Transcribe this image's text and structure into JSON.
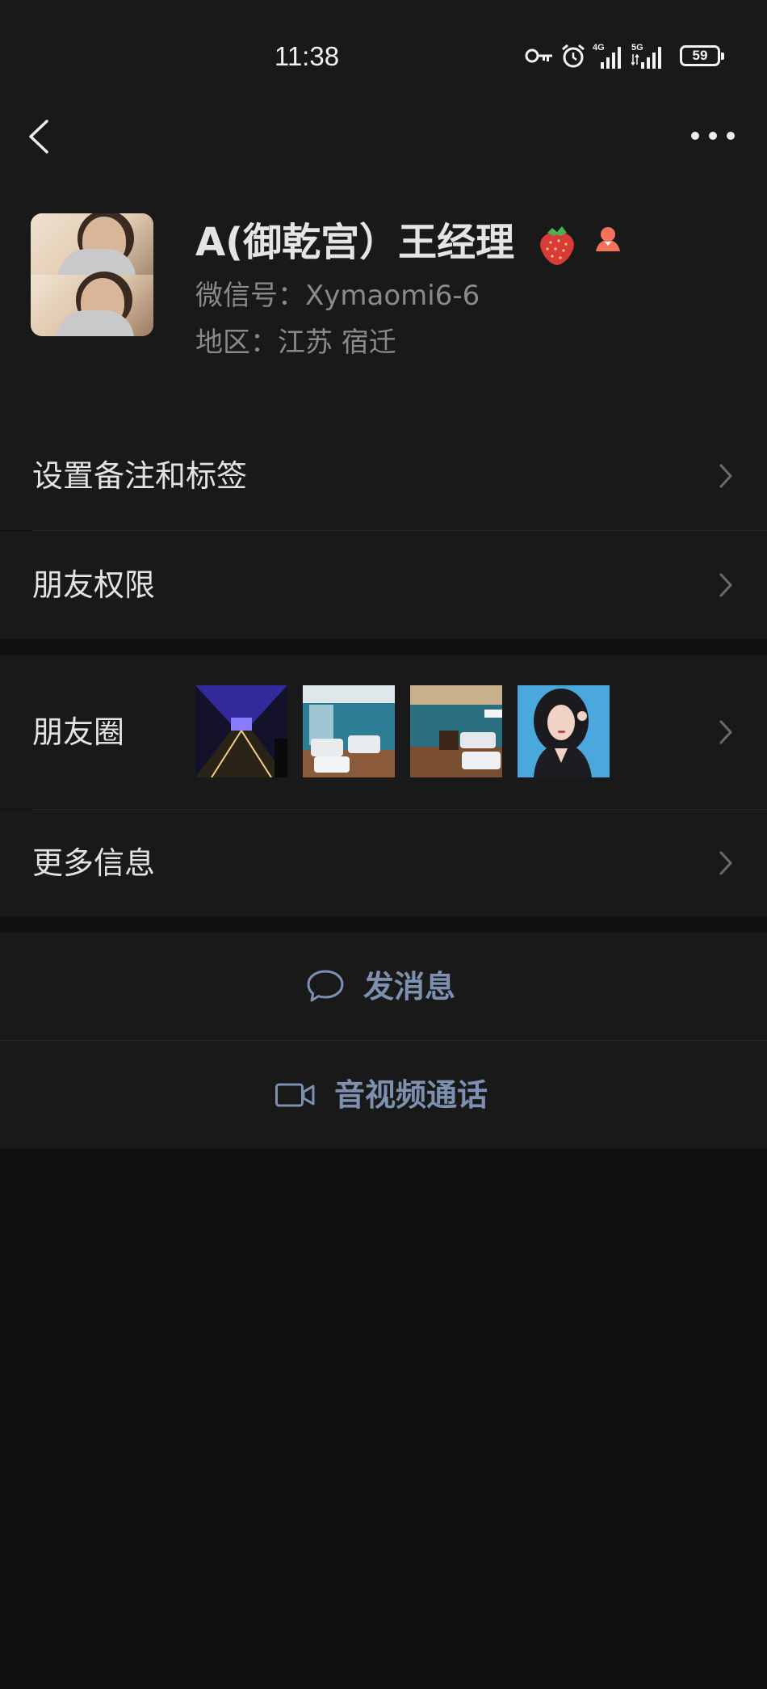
{
  "status_bar": {
    "time": "11:38",
    "signal_1": "4G",
    "signal_2": "5G",
    "battery": "59"
  },
  "nav": {
    "back_icon": "chevron-left-icon",
    "more_icon": "more-dots-icon"
  },
  "profile": {
    "name": "A(御乾宫）王经理",
    "name_emoji": "strawberry",
    "gender_icon": "female-icon",
    "wechat_id": "微信号：Xymaomi6-6",
    "region": "地区：江苏  宿迁"
  },
  "cells": {
    "remark_tags": "设置备注和标签",
    "permissions": "朋友权限",
    "moments": "朋友圈",
    "more_info": "更多信息"
  },
  "actions": {
    "message": "发消息",
    "video_call": "音视频通话"
  },
  "colors": {
    "background": "#111111",
    "panel": "#191919",
    "link_blue": "#7d90b0",
    "secondary_text": "#8a8a8a"
  }
}
